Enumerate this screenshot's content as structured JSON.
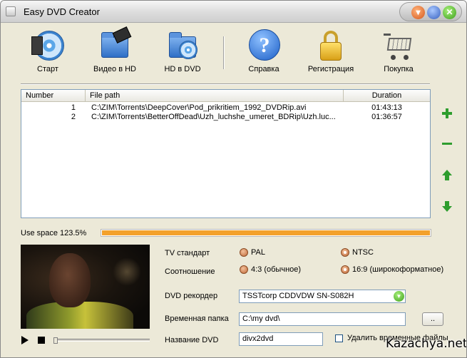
{
  "window": {
    "title": "Easy DVD Creator"
  },
  "toolbar": {
    "items": [
      {
        "label": "Старт",
        "icon": "disc-film-icon"
      },
      {
        "label": "Видео в HD",
        "icon": "folder-film-icon"
      },
      {
        "label": "HD в DVD",
        "icon": "folder-disc-icon"
      },
      {
        "label": "Справка",
        "icon": "help-icon"
      },
      {
        "label": "Регистрация",
        "icon": "lock-icon"
      },
      {
        "label": "Покупка",
        "icon": "cart-icon"
      }
    ]
  },
  "list": {
    "columns": [
      "Number",
      "File path",
      "Duration"
    ],
    "rows": [
      {
        "number": "1",
        "path": "C:\\ZIM\\Torrents\\DeepCover\\Pod_prikritiem_1992_DVDRip.avi",
        "duration": "01:43:13"
      },
      {
        "number": "2",
        "path": "C:\\ZIM\\Torrents\\BetterOffDead\\Uzh_luchshe_umeret_BDRip\\Uzh.luc...",
        "duration": "01:36:57"
      }
    ]
  },
  "side_buttons": [
    "plus-icon",
    "minus-icon",
    "arrow-up-icon",
    "arrow-down-icon"
  ],
  "usage": {
    "label": "Use space 123.5%",
    "fill_fraction": 1.0,
    "fill_color": "#f3a12c"
  },
  "settings": {
    "tv_standard_label": "TV стандарт",
    "pal_label": "PAL",
    "ntsc_label": "NTSC",
    "aspect_label": "Соотношение",
    "aspect_43_label": "4:3 (обычное)",
    "aspect_169_label": "16:9 (широкоформатное)",
    "recorder_label": "DVD рекордер",
    "recorder_value": "TSSTcorp CDDVDW SN-S082H",
    "temp_label": "Временная папка",
    "temp_value": "C:\\my dvd\\",
    "browse_label": "..",
    "name_label": "Название DVD",
    "name_value": "divx2dvd",
    "delete_label": "Удалить временные файлы"
  },
  "watermark": "Kazachya.net",
  "colors": {
    "accent_green": "#2e9d2e",
    "progress_orange": "#f3a12c"
  }
}
